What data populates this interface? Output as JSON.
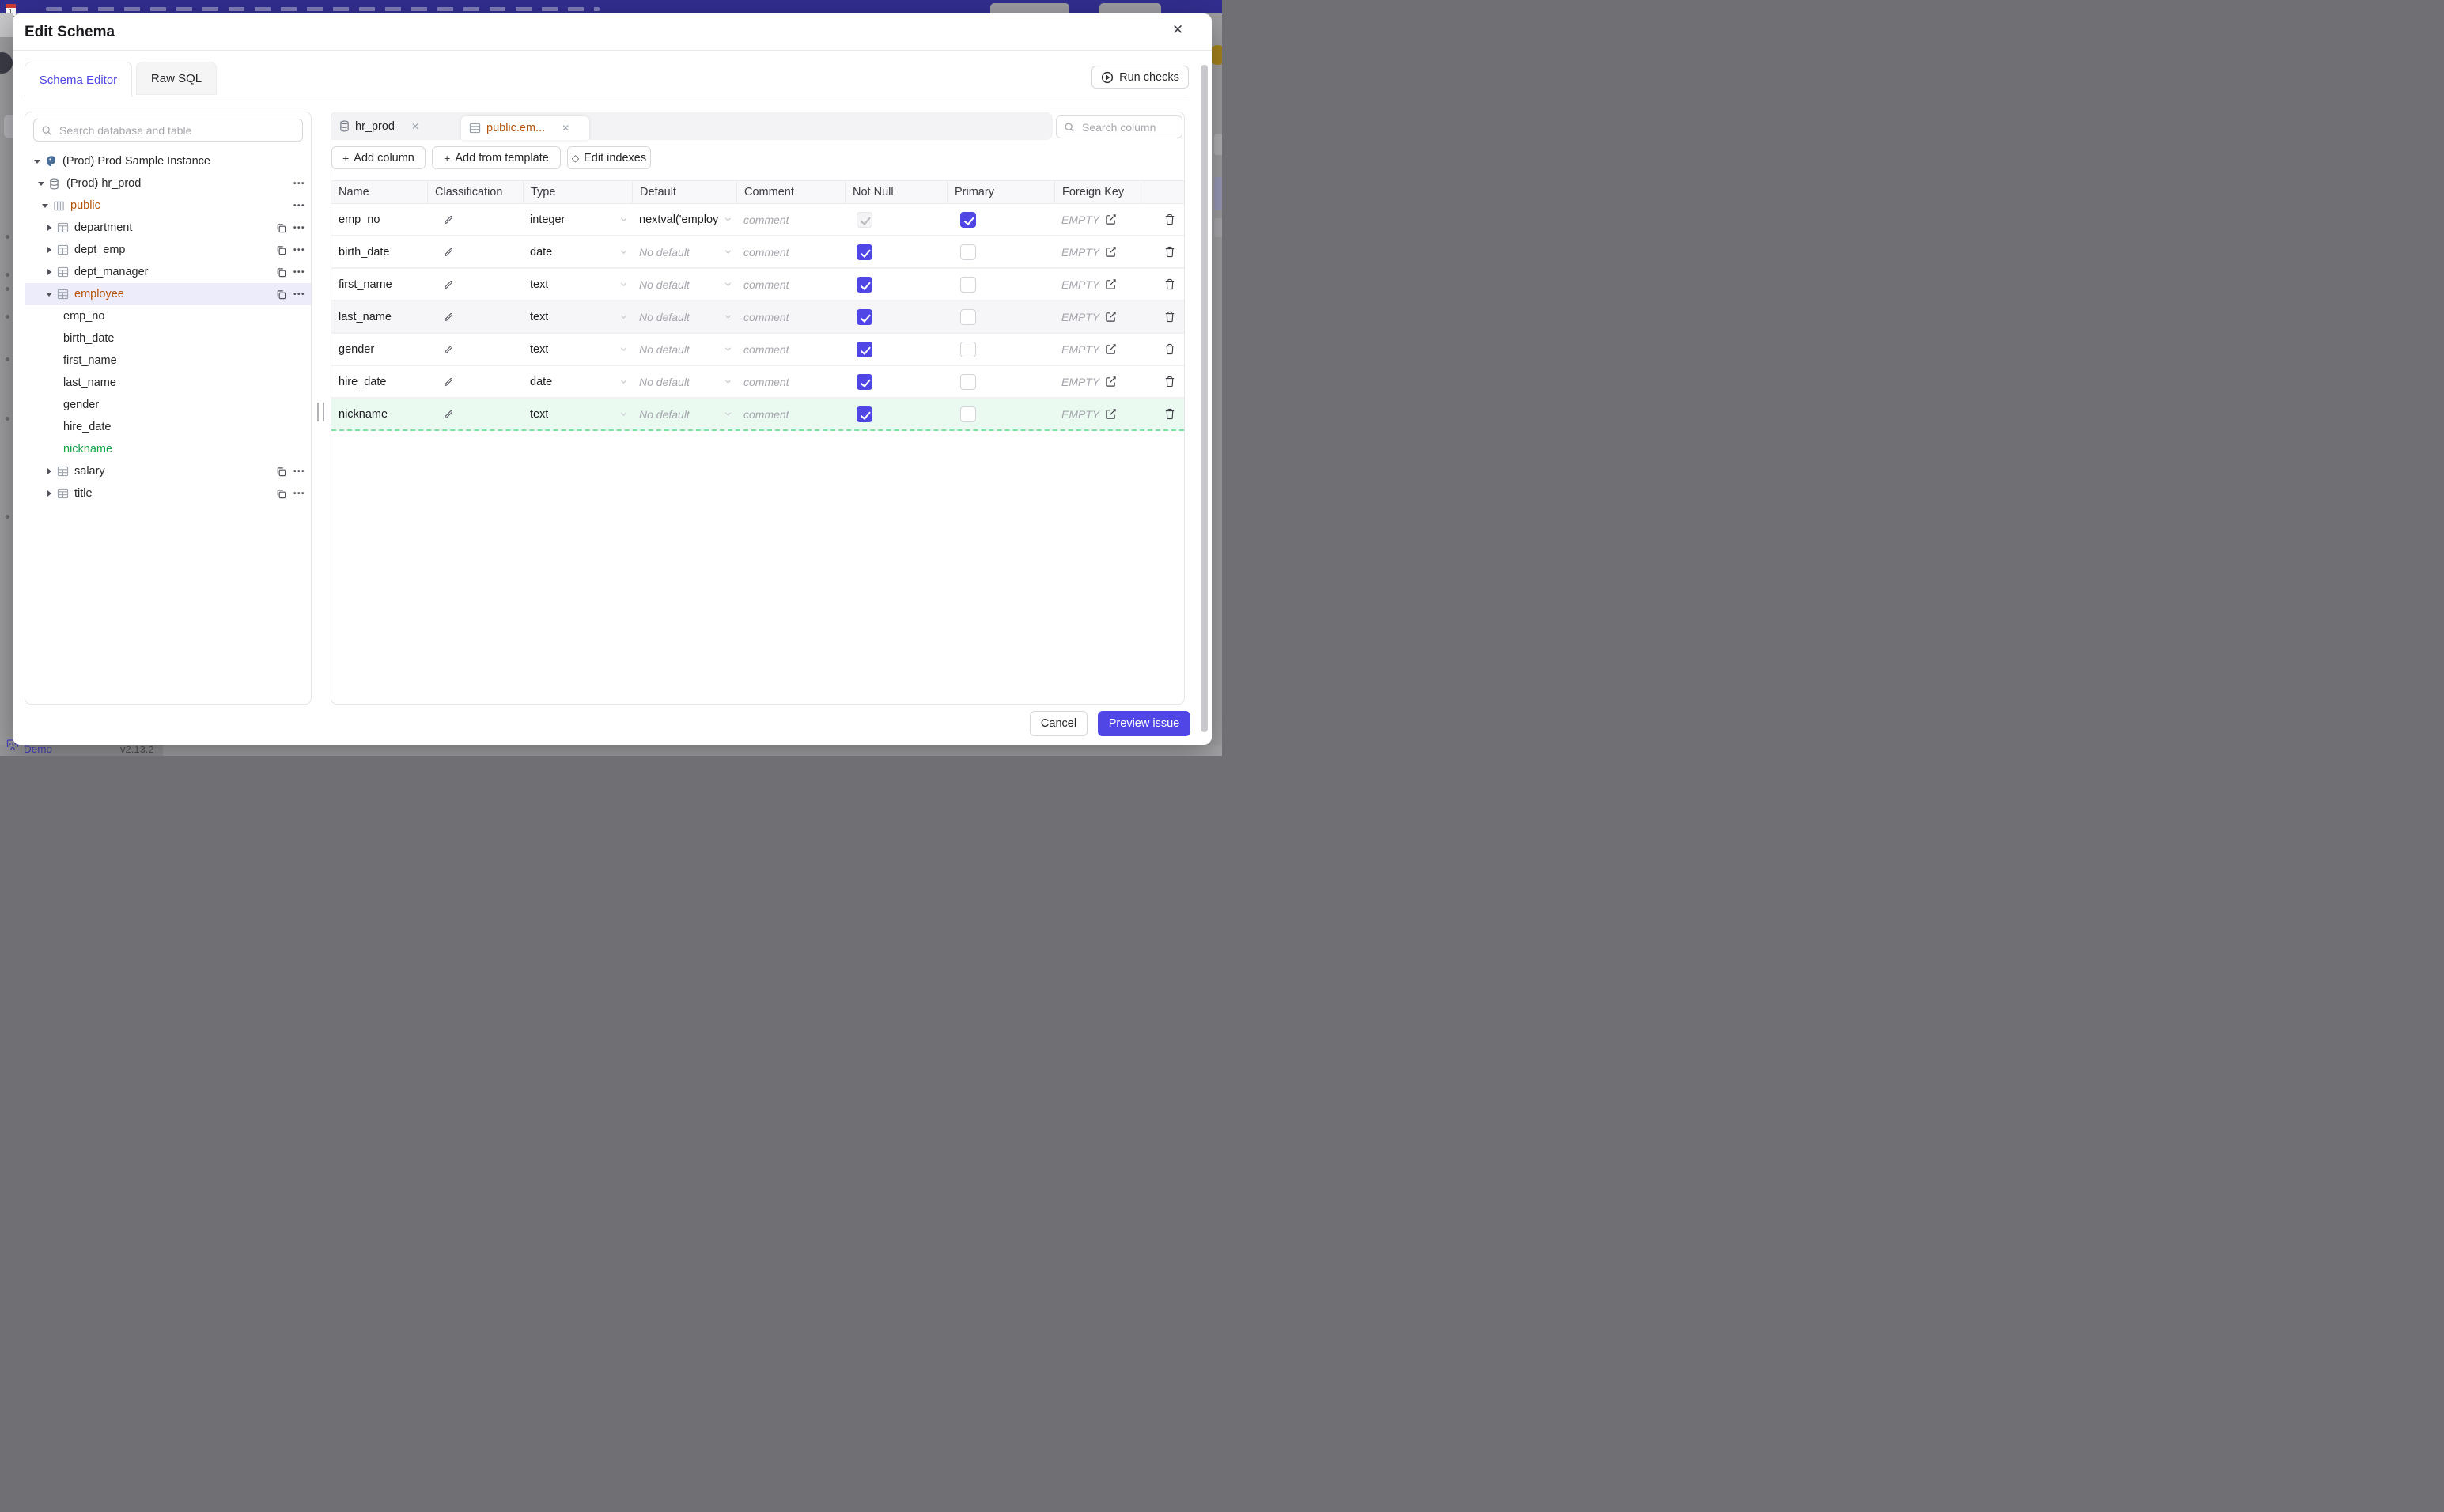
{
  "colors": {
    "primary": "#4f46e5",
    "amber": "#b45309",
    "green": "#16a34a",
    "topbar": "#322e90",
    "selected_row_bg": "#ececfb",
    "new_row_bg": "#eafaf1"
  },
  "backdrop": {
    "statusbar": {
      "demo": "Demo",
      "version": "v2.13.2"
    }
  },
  "modal": {
    "title": "Edit Schema",
    "close_glyph": "✕",
    "tabs": [
      {
        "label": "Schema Editor",
        "active": true
      },
      {
        "label": "Raw SQL",
        "active": false
      }
    ],
    "run_checks_label": "Run checks",
    "sidebar": {
      "search_placeholder": "Search database and table",
      "tree": [
        {
          "label": "(Prod) Prod Sample Instance",
          "level": 0,
          "caret": "down",
          "icon": "postgres"
        },
        {
          "label": "(Prod) hr_prod",
          "level": 1,
          "caret": "down",
          "icon": "database",
          "actions": [
            "more"
          ]
        },
        {
          "label": "public",
          "level": 2,
          "caret": "down",
          "icon": "schema",
          "color": "amber",
          "actions": [
            "more"
          ]
        },
        {
          "label": "department",
          "level": 3,
          "caret": "right",
          "icon": "table",
          "actions": [
            "copy",
            "more"
          ]
        },
        {
          "label": "dept_emp",
          "level": 3,
          "caret": "right",
          "icon": "table",
          "actions": [
            "copy",
            "more"
          ]
        },
        {
          "label": "dept_manager",
          "level": 3,
          "caret": "right",
          "icon": "table",
          "actions": [
            "copy",
            "more"
          ]
        },
        {
          "label": "employee",
          "level": 3,
          "caret": "down",
          "icon": "table",
          "color": "amber",
          "selected": true,
          "actions": [
            "copy",
            "more"
          ]
        },
        {
          "label": "emp_no",
          "level": 4
        },
        {
          "label": "birth_date",
          "level": 4
        },
        {
          "label": "first_name",
          "level": 4
        },
        {
          "label": "last_name",
          "level": 4
        },
        {
          "label": "gender",
          "level": 4
        },
        {
          "label": "hire_date",
          "level": 4
        },
        {
          "label": "nickname",
          "level": 4,
          "color": "green"
        },
        {
          "label": "salary",
          "level": 3,
          "caret": "right",
          "icon": "table",
          "actions": [
            "copy",
            "more"
          ]
        },
        {
          "label": "title",
          "level": 3,
          "caret": "right",
          "icon": "table",
          "actions": [
            "copy",
            "more"
          ]
        }
      ]
    },
    "editor": {
      "chips": [
        {
          "label": "hr_prod",
          "icon": "database",
          "active": false
        },
        {
          "label": "public.em...",
          "icon": "table",
          "active": true
        }
      ],
      "column_search_placeholder": "Search column",
      "toolbar": [
        {
          "glyph": "+",
          "label": "Add column"
        },
        {
          "glyph": "+",
          "label": "Add from template"
        },
        {
          "glyph": "◇",
          "label": "Edit indexes"
        }
      ],
      "table": {
        "headers": [
          "Name",
          "Classification",
          "Type",
          "Default",
          "Comment",
          "Not Null",
          "Primary",
          "Foreign Key",
          ""
        ],
        "comment_placeholder": "comment",
        "default_placeholder": "No default",
        "foreign_key_placeholder": "EMPTY",
        "rows": [
          {
            "name": "emp_no",
            "type": "integer",
            "default": "nextval('employ",
            "not_null_checked": true,
            "not_null_disabled": true,
            "primary_checked": true,
            "foreign_key": "EMPTY"
          },
          {
            "name": "birth_date",
            "type": "date",
            "default": null,
            "not_null_checked": true,
            "primary_checked": false,
            "foreign_key": "EMPTY"
          },
          {
            "name": "first_name",
            "type": "text",
            "default": null,
            "not_null_checked": true,
            "primary_checked": false,
            "foreign_key": "EMPTY"
          },
          {
            "name": "last_name",
            "type": "text",
            "default": null,
            "not_null_checked": true,
            "primary_checked": false,
            "foreign_key": "EMPTY",
            "hovered": true
          },
          {
            "name": "gender",
            "type": "text",
            "default": null,
            "not_null_checked": true,
            "primary_checked": false,
            "foreign_key": "EMPTY"
          },
          {
            "name": "hire_date",
            "type": "date",
            "default": null,
            "not_null_checked": true,
            "primary_checked": false,
            "foreign_key": "EMPTY"
          },
          {
            "name": "nickname",
            "type": "text",
            "default": null,
            "not_null_checked": true,
            "primary_checked": false,
            "foreign_key": "EMPTY",
            "is_new": true
          }
        ]
      }
    },
    "footer": {
      "cancel_label": "Cancel",
      "submit_label": "Preview issue"
    }
  }
}
